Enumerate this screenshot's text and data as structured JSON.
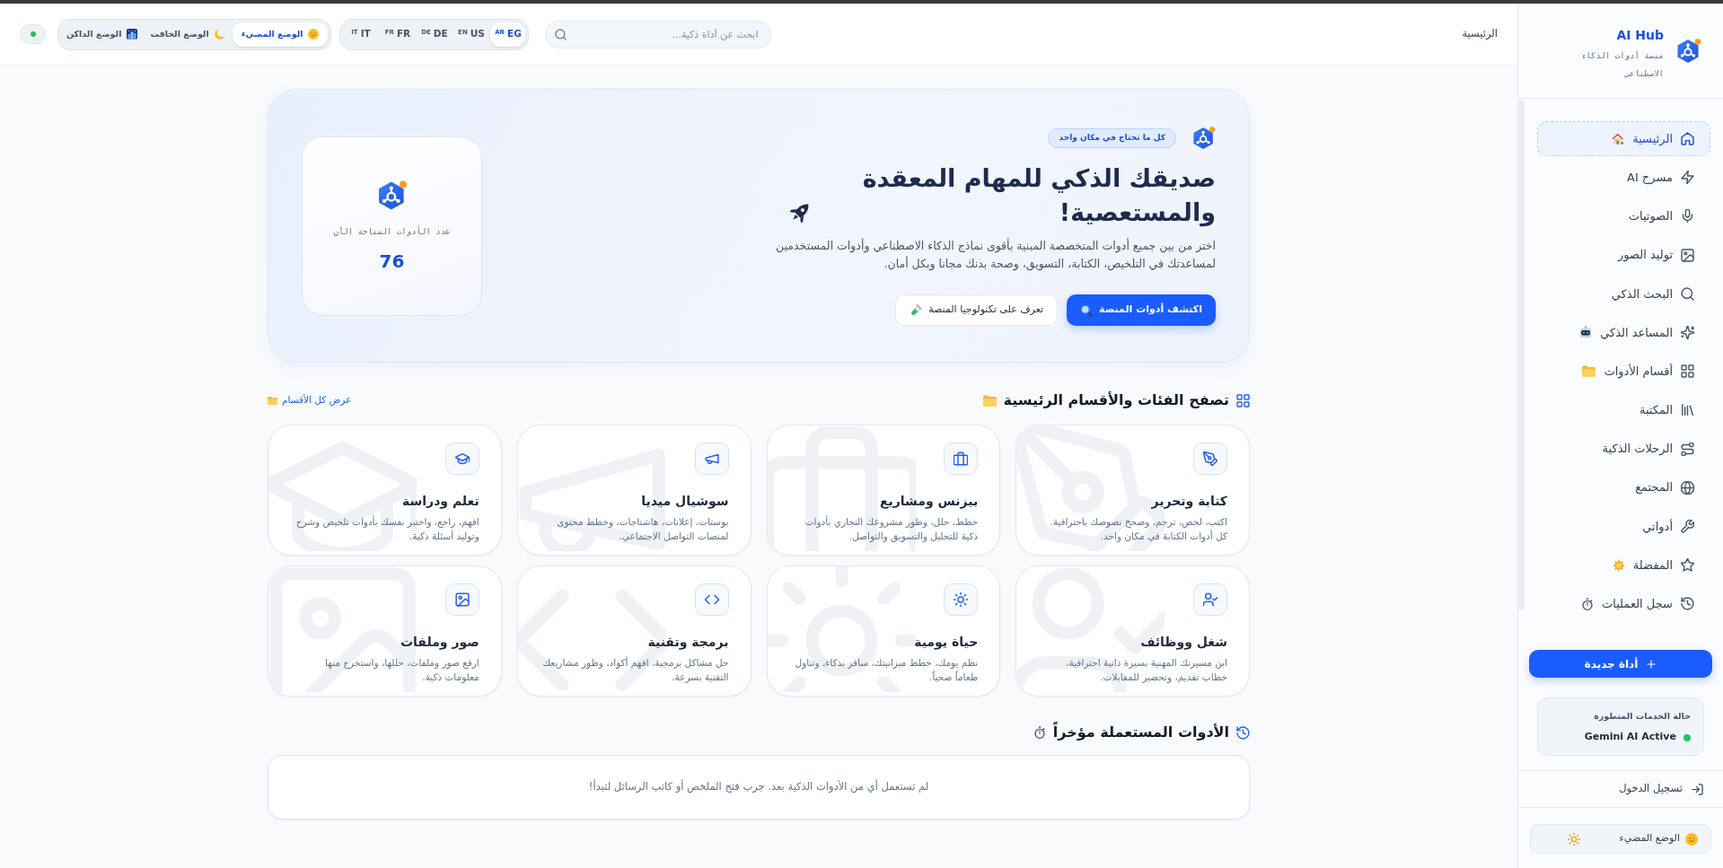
{
  "topbar": {
    "page_title": "الرئيسية",
    "search": {
      "placeholder": "ابحث عن أداة ذكية..."
    },
    "languages": [
      {
        "code": "AR",
        "country": "EG",
        "selected": true
      },
      {
        "code": "EN",
        "country": "US",
        "selected": false
      },
      {
        "code": "DE",
        "country": "DE",
        "selected": false
      },
      {
        "code": "FR",
        "country": "FR",
        "selected": false
      },
      {
        "code": "IT",
        "country": "IT",
        "selected": false
      }
    ],
    "themes": [
      {
        "label": "الوضع المضيء",
        "selected": true
      },
      {
        "label": "الوضع الخافت",
        "selected": false
      },
      {
        "label": "الوضع الداكن",
        "selected": false
      }
    ],
    "status": {
      "online": true
    }
  },
  "sidebar": {
    "brand": {
      "name": "AI Hub",
      "tagline": "منصة أدوات الذكاء الاصطناعي"
    },
    "items": [
      {
        "label": "الرئيسية",
        "selected": true
      },
      {
        "label": "مسرح AI",
        "selected": false
      },
      {
        "label": "الصوتيات",
        "selected": false
      },
      {
        "label": "توليد الصور",
        "selected": false
      },
      {
        "label": "البحث الذكي",
        "selected": false
      },
      {
        "label": "المساعد الذكي",
        "selected": false
      },
      {
        "label": "أقسام الأدوات",
        "selected": false
      },
      {
        "label": "المكتبة",
        "selected": false
      },
      {
        "label": "الرحلات الذكية",
        "selected": false
      },
      {
        "label": "المجتمع",
        "selected": false
      },
      {
        "label": "أدواتي",
        "selected": false
      },
      {
        "label": "المفضلة",
        "selected": false
      },
      {
        "label": "سجل العمليات",
        "selected": false
      }
    ],
    "new_tool_button": "أداة جديدة",
    "services_status": {
      "title": "حالة الخدمات المتطورة",
      "service": "Gemini AI Active",
      "online": true
    },
    "login": "تسجيل الدخول",
    "theme_button": "الوضع المضيء"
  },
  "hero": {
    "badge": "كل ما تحتاج في مكان واحد",
    "title": "صديقك الذكي للمهام المعقدة والمستعصية!",
    "description": "اختر من بين جميع أدوات المتخصصة المبنية بأقوى نماذج الذكاء الاصطناعي وأدوات المستخدمين لمساعدتك في التلخيص، الكتابة، التسويق، وصحة بدنك مجانا وبكل أمان.",
    "buttons": [
      {
        "label": "اكتشف أدوات المنصة",
        "kind": "primary"
      },
      {
        "label": "تعرف على تكنولوجيا المنصة",
        "kind": "secondary"
      }
    ],
    "stats": {
      "label": "عدد الأدوات المتاحة الآن",
      "value": "76"
    }
  },
  "categories": {
    "title": "تصفح الفئات والأقسام الرئيسية",
    "view_all": "عرض كل الأقسام",
    "items": [
      {
        "title": "كتابة وتحرير",
        "description": "اكتب، لخص، ترجم، وصحح نصوصك باحترافية. كل أدوات الكتابة في مكان واحد."
      },
      {
        "title": "بيزنس ومشاريع",
        "description": "خطط، حلل، وطور مشروعك التجاري بأدوات ذكية للتحليل والتسويق والتواصل."
      },
      {
        "title": "سوشيال ميديا",
        "description": "بوستات، إعلانات، هاشتاجات، وخطط محتوى لمنصات التواصل الاجتماعي."
      },
      {
        "title": "تعلم ودراسة",
        "description": "افهم، راجع، واختبر نفسك بأدوات تلخيص وشرح وتوليد أسئلة ذكية."
      },
      {
        "title": "شغل ووظائف",
        "description": "ابن مسيرتك المهنية بسيرة ذاتية احترافية، خطاب تقديم، وتحضير للمقابلات."
      },
      {
        "title": "حياة يومية",
        "description": "نظم يومك، خطط ميزانيتك، سافر بذكاء، وتناول طعاماً صحياً."
      },
      {
        "title": "برمجة وتقنية",
        "description": "حل مشاكل برمجية، افهم أكواد، وطور مشاريعك التقنية بسرعة."
      },
      {
        "title": "صور وملفات",
        "description": "ارفع صور وملفات، حللها، واستخرج منها معلومات ذكية."
      }
    ]
  },
  "recent": {
    "title": "الأدوات المستعملة مؤخراً",
    "empty_message": "لم تستعمل أي من الأدوات الذكية بعد. جرب فتح الملخص أو كاتب الرسائل لتبدأ!"
  }
}
